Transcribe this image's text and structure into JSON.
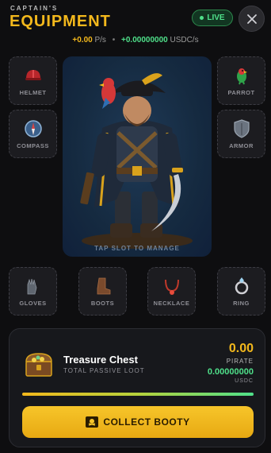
{
  "header": {
    "subtitle": "CAPTAIN'S",
    "title": "EQUIPMENT",
    "live_label": "LIVE",
    "close_icon": "close-icon"
  },
  "rates": {
    "pirate_rate": "+0.00",
    "pirate_unit": "P/s",
    "separator": "•",
    "usdc_rate": "+0.00000000",
    "usdc_unit": "USDC/s"
  },
  "slots": {
    "helmet": {
      "label": "HELMET",
      "icon": "helmet-icon"
    },
    "compass": {
      "label": "COMPASS",
      "icon": "compass-icon"
    },
    "parrot": {
      "label": "PARROT",
      "icon": "parrot-icon"
    },
    "armor": {
      "label": "ARMOR",
      "icon": "shield-icon"
    },
    "gloves": {
      "label": "GLOVES",
      "icon": "gloves-icon"
    },
    "boots": {
      "label": "BOOTS",
      "icon": "boot-icon"
    },
    "necklace": {
      "label": "NECKLACE",
      "icon": "necklace-icon"
    },
    "ring": {
      "label": "RING",
      "icon": "ring-icon"
    }
  },
  "portrait": {
    "hint": "TAP SLOT TO MANAGE"
  },
  "treasure": {
    "title": "Treasure Chest",
    "subtitle": "TOTAL PASSIVE LOOT",
    "pirate_value": "0.00",
    "pirate_unit": "PIRATE",
    "usdc_value": "0.00000000",
    "usdc_unit": "USDC",
    "progress_fraction": 1.0,
    "button_label": "COLLECT BOOTY",
    "button_icon": "pirate-flag-icon"
  },
  "colors": {
    "accent_gold": "#f3b81c",
    "accent_green": "#4fe08a",
    "background": "#0e0e10"
  }
}
